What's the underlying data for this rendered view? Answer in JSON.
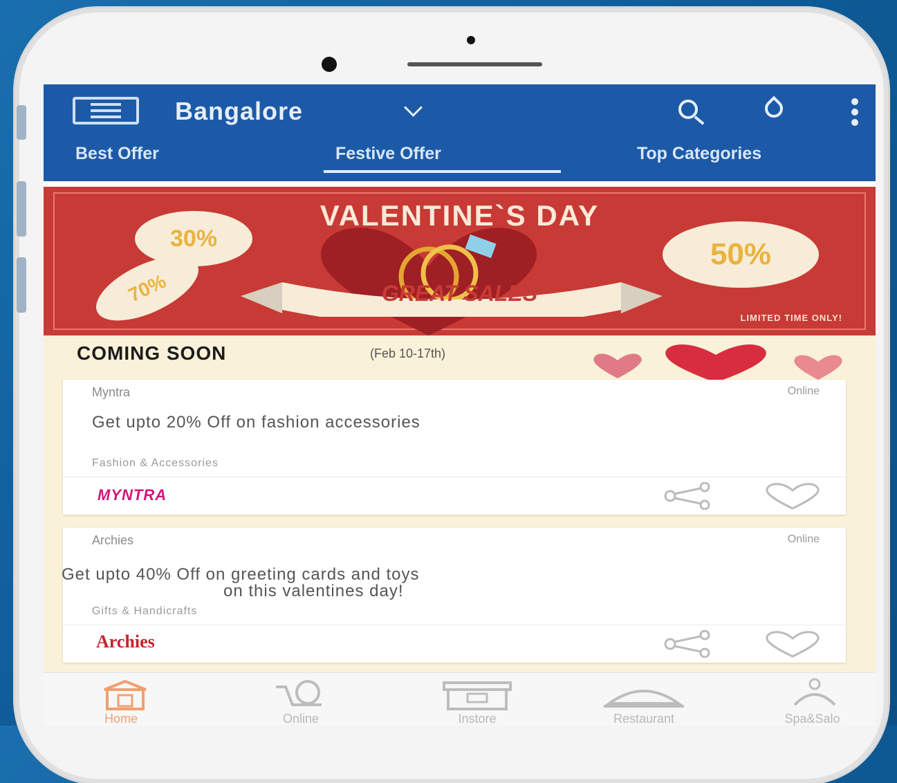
{
  "header": {
    "city": "Bangalore",
    "tabs": [
      {
        "label": "Best Offer",
        "active": false
      },
      {
        "label": "Festive Offer",
        "active": true
      },
      {
        "label": "Top Categories",
        "active": false
      }
    ],
    "icons": [
      "menu-icon",
      "search-icon",
      "drop-icon",
      "more-icon"
    ]
  },
  "banner": {
    "title": "VALENTINE`S DAY",
    "ribbon": "GREAT SALES",
    "badges": [
      "30%",
      "70%",
      "50%"
    ],
    "footer": "LIMITED TIME ONLY!"
  },
  "section": {
    "title": "COMING SOON",
    "dates": "(Feb 10-17th)"
  },
  "offers": [
    {
      "store": "Myntra",
      "channel": "Online",
      "description": "Get upto 20% Off on fashion accessories",
      "category": "Fashion & Accessories",
      "logo": "MYNTRA"
    },
    {
      "store": "Archies",
      "channel": "Online",
      "description_line1": "Get upto 40% Off on greeting cards and toys",
      "description_line2": "on this valentines day!",
      "category": "Gifts & Handicrafts",
      "logo": "Archies"
    }
  ],
  "bottom_nav": [
    {
      "label": "Home",
      "active": true,
      "icon": "home-icon"
    },
    {
      "label": "Online",
      "active": false,
      "icon": "cart-icon"
    },
    {
      "label": "Instore",
      "active": false,
      "icon": "store-icon"
    },
    {
      "label": "Restaurant",
      "active": false,
      "icon": "dish-icon"
    },
    {
      "label": "Spa&Salo",
      "active": false,
      "icon": "spa-icon"
    }
  ],
  "colors": {
    "header": "#1c5aa8",
    "banner": "#c83a35",
    "section_bg": "#faf1d9",
    "accent": "#f0a070"
  }
}
